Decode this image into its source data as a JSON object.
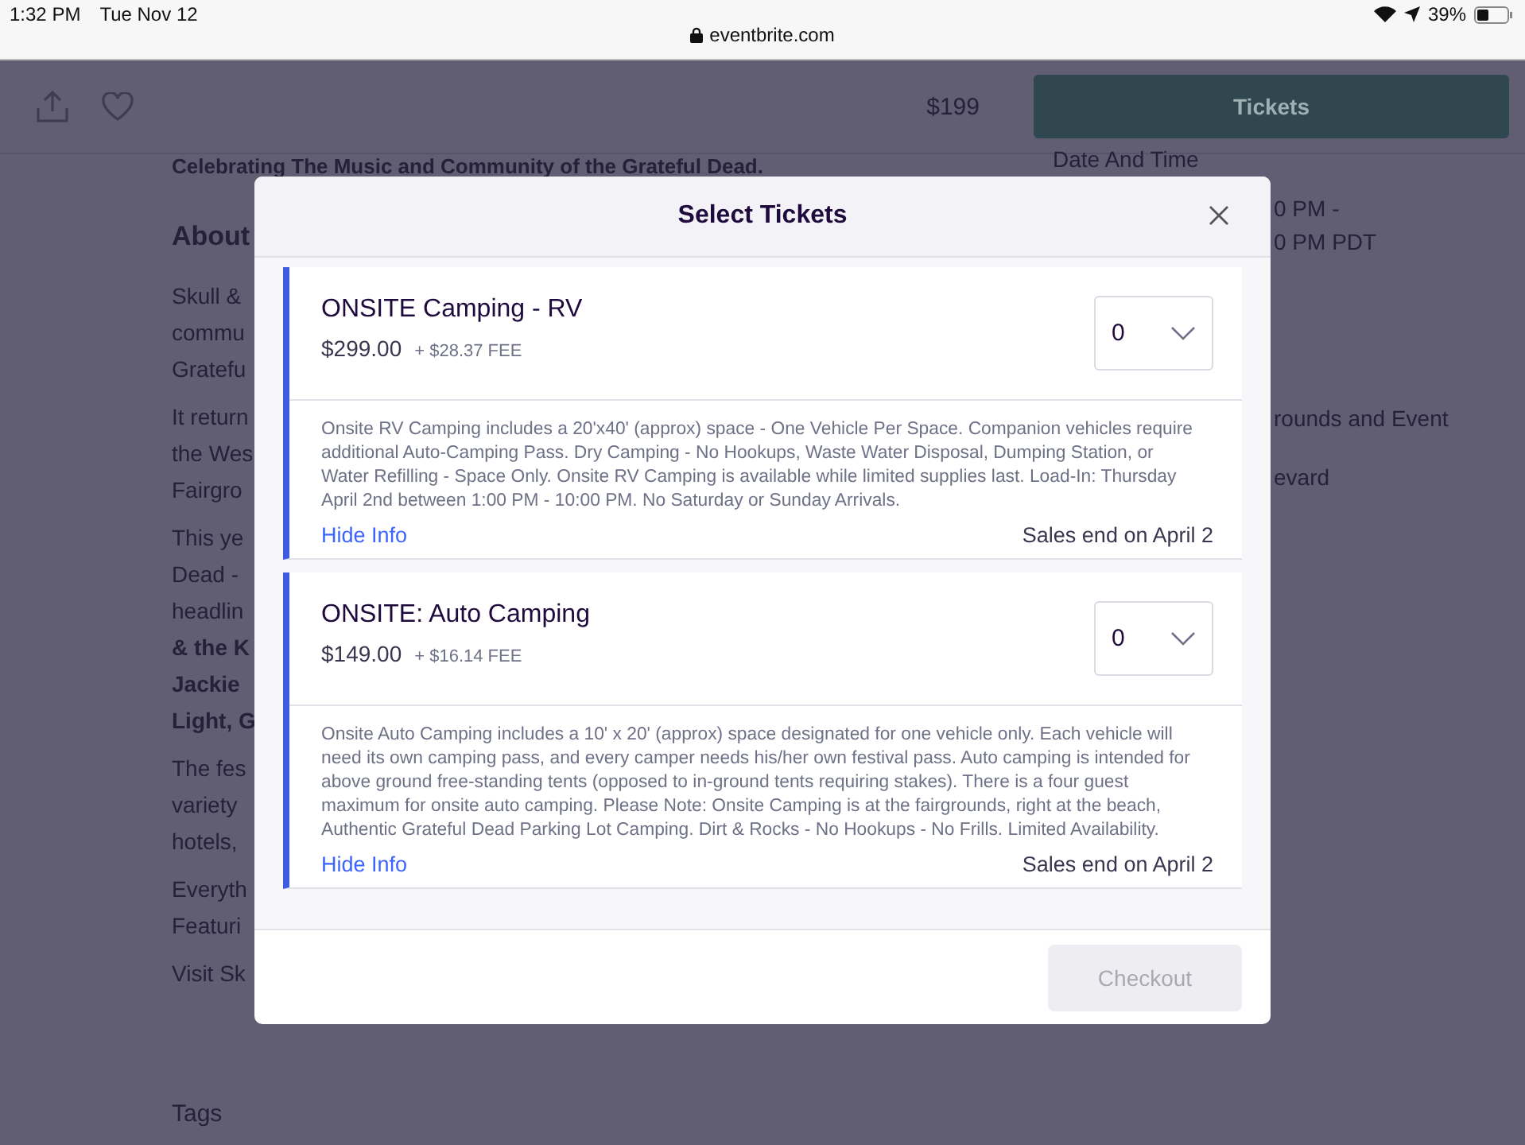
{
  "status_bar": {
    "time": "1:32 PM",
    "date": "Tue Nov 12",
    "battery": "39%"
  },
  "browser": {
    "url": "eventbrite.com"
  },
  "toolbar": {
    "price": "$199",
    "button": "Tickets"
  },
  "page": {
    "subtitle": "Celebrating The Music and Community of the Grateful Dead.",
    "left_fragments": [
      {
        "kind": "heading",
        "text": "About"
      },
      {
        "kind": "para",
        "lines": [
          "Skull &",
          "commu",
          "Gratefu"
        ]
      },
      {
        "kind": "para",
        "lines": [
          "It return",
          "the Wes",
          "Fairgro"
        ]
      },
      {
        "kind": "para",
        "lines": [
          "This ye",
          "Dead -",
          "headlin"
        ]
      },
      {
        "kind": "bold",
        "lines": [
          "& the K",
          "Jackie",
          "Light, G"
        ]
      },
      {
        "kind": "para",
        "lines": [
          "The fes",
          "variety",
          "hotels,"
        ]
      },
      {
        "kind": "para",
        "lines": [
          "Everyth",
          "Featuri"
        ]
      },
      {
        "kind": "para",
        "lines": [
          "Visit Sk"
        ]
      }
    ],
    "tags_heading": "Tags",
    "right_heading": "Date And Time",
    "right_fragments": [
      [
        "0 PM -",
        "0 PM PDT"
      ],
      [
        "rounds and Event"
      ],
      [
        "evard"
      ]
    ]
  },
  "modal": {
    "title": "Select Tickets",
    "checkout": "Checkout",
    "checkout_disabled": true,
    "tickets": [
      {
        "name": "ONSITE Camping - RV",
        "price": "$299.00",
        "fee": "+ $28.37 FEE",
        "quantity": "0",
        "description": "Onsite RV Camping includes a 20'x40' (approx) space - One Vehicle Per Space. Companion vehicles require additional Auto-Camping Pass. Dry Camping - No Hookups, Waste Water Disposal, Dumping Station, or Water Refilling - Space Only. Onsite RV Camping is available while limited supplies last. Load-In: Thursday April 2nd between 1:00 PM - 10:00 PM. No Saturday or Sunday Arrivals.",
        "toggle": "Hide Info",
        "sales_end": "Sales end on April 2",
        "expanded": true
      },
      {
        "name": "ONSITE: Auto Camping",
        "price": "$149.00",
        "fee": "+ $16.14 FEE",
        "quantity": "0",
        "description": "Onsite Auto Camping includes a 10' x 20' (approx) space designated for one vehicle only. Each vehicle will need its own camping pass, and every camper needs his/her own festival pass. Auto camping is intended for above ground free-standing tents (opposed to in-ground tents requiring stakes). There is a four guest maximum for onsite auto camping. Please Note: Onsite Camping is at the fairgrounds, right at the beach, Authentic Grateful Dead Parking Lot Camping. Dirt & Rocks - No Hookups - No Frills. Limited Availability.",
        "toggle": "Hide Info",
        "sales_end": "Sales end on April 2",
        "expanded": true
      }
    ]
  }
}
